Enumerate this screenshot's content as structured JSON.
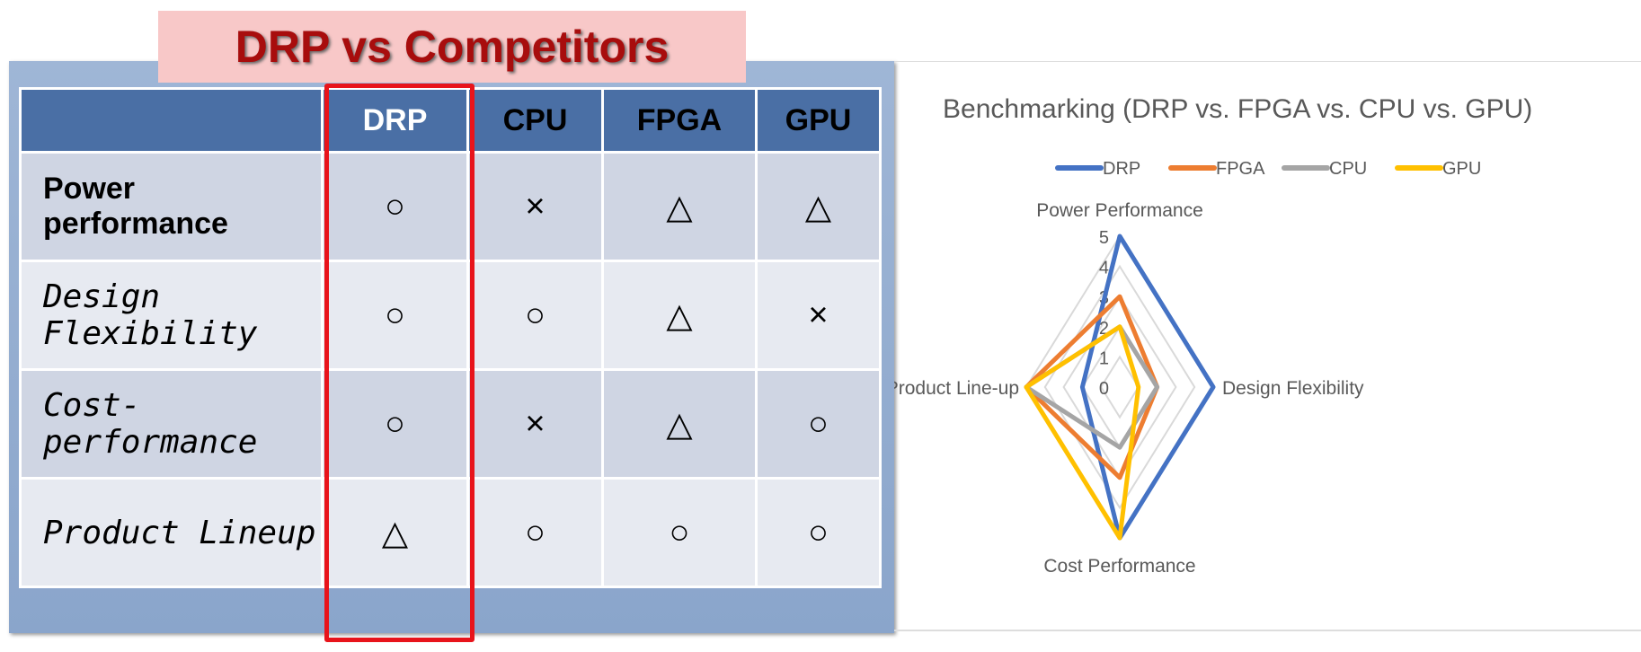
{
  "title": "DRP vs Competitors",
  "table": {
    "headers": [
      "",
      "DRP",
      "CPU",
      "FPGA",
      "GPU"
    ],
    "rows": [
      {
        "label": "Power performance",
        "cells": [
          "○",
          "×",
          "△",
          "△"
        ]
      },
      {
        "label": "Design Flexibility",
        "cells": [
          "○",
          "○",
          "△",
          "×"
        ]
      },
      {
        "label": "Cost-performance",
        "cells": [
          "○",
          "×",
          "△",
          "○"
        ]
      },
      {
        "label": "Product Lineup",
        "cells": [
          "△",
          "○",
          "○",
          "○"
        ]
      }
    ],
    "highlight_color": "#e8141b"
  },
  "chart_data": {
    "type": "radar",
    "title": "Benchmarking (DRP vs. FPGA vs. CPU vs. GPU)",
    "categories": [
      "Power Performance",
      "Design Flexibility",
      "Cost Performance",
      "Product Line-up"
    ],
    "range": [
      0,
      5
    ],
    "ticks": [
      "0",
      "1",
      "2",
      "3",
      "4",
      "5"
    ],
    "legend": "top",
    "series": [
      {
        "name": "DRP",
        "color": "#4472c4",
        "values": [
          5,
          5,
          5,
          2
        ]
      },
      {
        "name": "FPGA",
        "color": "#ed7d31",
        "values": [
          3,
          2,
          3,
          5
        ]
      },
      {
        "name": "CPU",
        "color": "#a5a5a5",
        "values": [
          2,
          2,
          2,
          5
        ]
      },
      {
        "name": "GPU",
        "color": "#ffc000",
        "values": [
          2,
          1,
          5,
          5
        ]
      }
    ]
  }
}
